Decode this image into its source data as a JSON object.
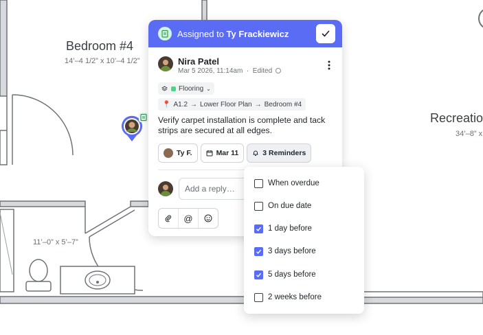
{
  "floorplan": {
    "bedroom_name": "Bedroom #4",
    "bedroom_dims": "14’–4 1/2” x 10’–4 1/2”",
    "recreation_name": "Recreatio",
    "recreation_dims": "34’–8” x",
    "bath_dims": "11’–0” x 5’–7”"
  },
  "card": {
    "header_prefix": "Assigned to ",
    "header_assignee": "Ty Frackiewicz",
    "author_name": "Nira Patel",
    "author_date": "Mar 5 2026, 11:14am",
    "author_edited": "Edited",
    "tag_label": "Flooring",
    "crumbs": [
      "A1.2",
      "Lower Floor Plan",
      "Bedroom #4"
    ],
    "body": "Verify carpet installation is complete and tack strips are secured at all edges.",
    "assignee_chip": "Ty F.",
    "date_chip": "Mar 11",
    "reminders_chip": "3 Reminders",
    "reply_placeholder": "Add a reply…"
  },
  "reminders": [
    {
      "label": "When overdue",
      "checked": false
    },
    {
      "label": "On due date",
      "checked": false
    },
    {
      "label": "1 day before",
      "checked": true
    },
    {
      "label": "3 days before",
      "checked": true
    },
    {
      "label": "5 days before",
      "checked": true
    },
    {
      "label": "2 weeks before",
      "checked": false
    }
  ],
  "colors": {
    "accent": "#5b6cf4",
    "tag_green": "#4fd38a"
  }
}
